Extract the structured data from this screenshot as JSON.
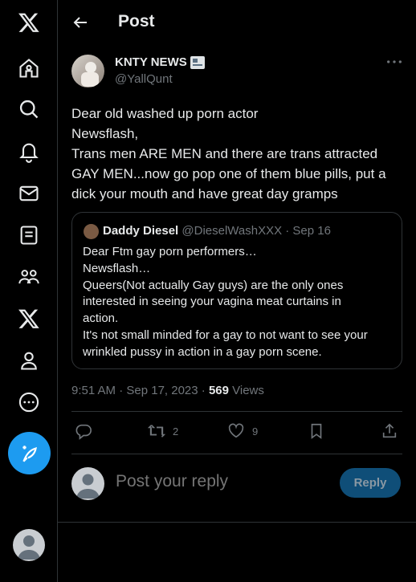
{
  "sidebar": {
    "items": [
      {
        "icon": "x-logo-icon"
      },
      {
        "icon": "home-icon"
      },
      {
        "icon": "search-icon"
      },
      {
        "icon": "bell-icon"
      },
      {
        "icon": "mail-icon"
      },
      {
        "icon": "lists-icon"
      },
      {
        "icon": "communities-icon"
      },
      {
        "icon": "x-premium-icon"
      },
      {
        "icon": "profile-icon"
      },
      {
        "icon": "more-circle-icon"
      }
    ],
    "compose_icon": "compose-feather-icon"
  },
  "header": {
    "title": "Post"
  },
  "tweet": {
    "author_name": "KNTY NEWS",
    "author_handle": "@YallQunt",
    "lines": [
      "Dear old washed up porn actor",
      "Newsflash,",
      "Trans men ARE MEN and there are trans attracted",
      "GAY MEN...now go pop one of them blue pills, put a",
      "dick your mouth and have great day gramps"
    ],
    "time": "9:51 AM · Sep 17, 2023 · ",
    "views_count": "569",
    "views_label": " Views"
  },
  "quote": {
    "name": "Daddy Diesel",
    "meta": " @DieselWashXXX · Sep 16",
    "lines": [
      "Dear Ftm gay porn performers…",
      "Newsflash…",
      "Queers(Not actually Gay guys) are the only ones",
      "interested in seeing your vagina meat curtains in",
      "action.",
      "It's not small minded for a gay to not want to see your",
      "wrinkled pussy in action in a gay porn scene."
    ]
  },
  "actions": {
    "reply_count": "",
    "repost_count": "2",
    "like_count": "9"
  },
  "reply": {
    "placeholder": "Post your reply",
    "button": "Reply"
  },
  "colors": {
    "accent": "#1d9bf0",
    "muted": "#71767b",
    "border": "#2f3336"
  }
}
